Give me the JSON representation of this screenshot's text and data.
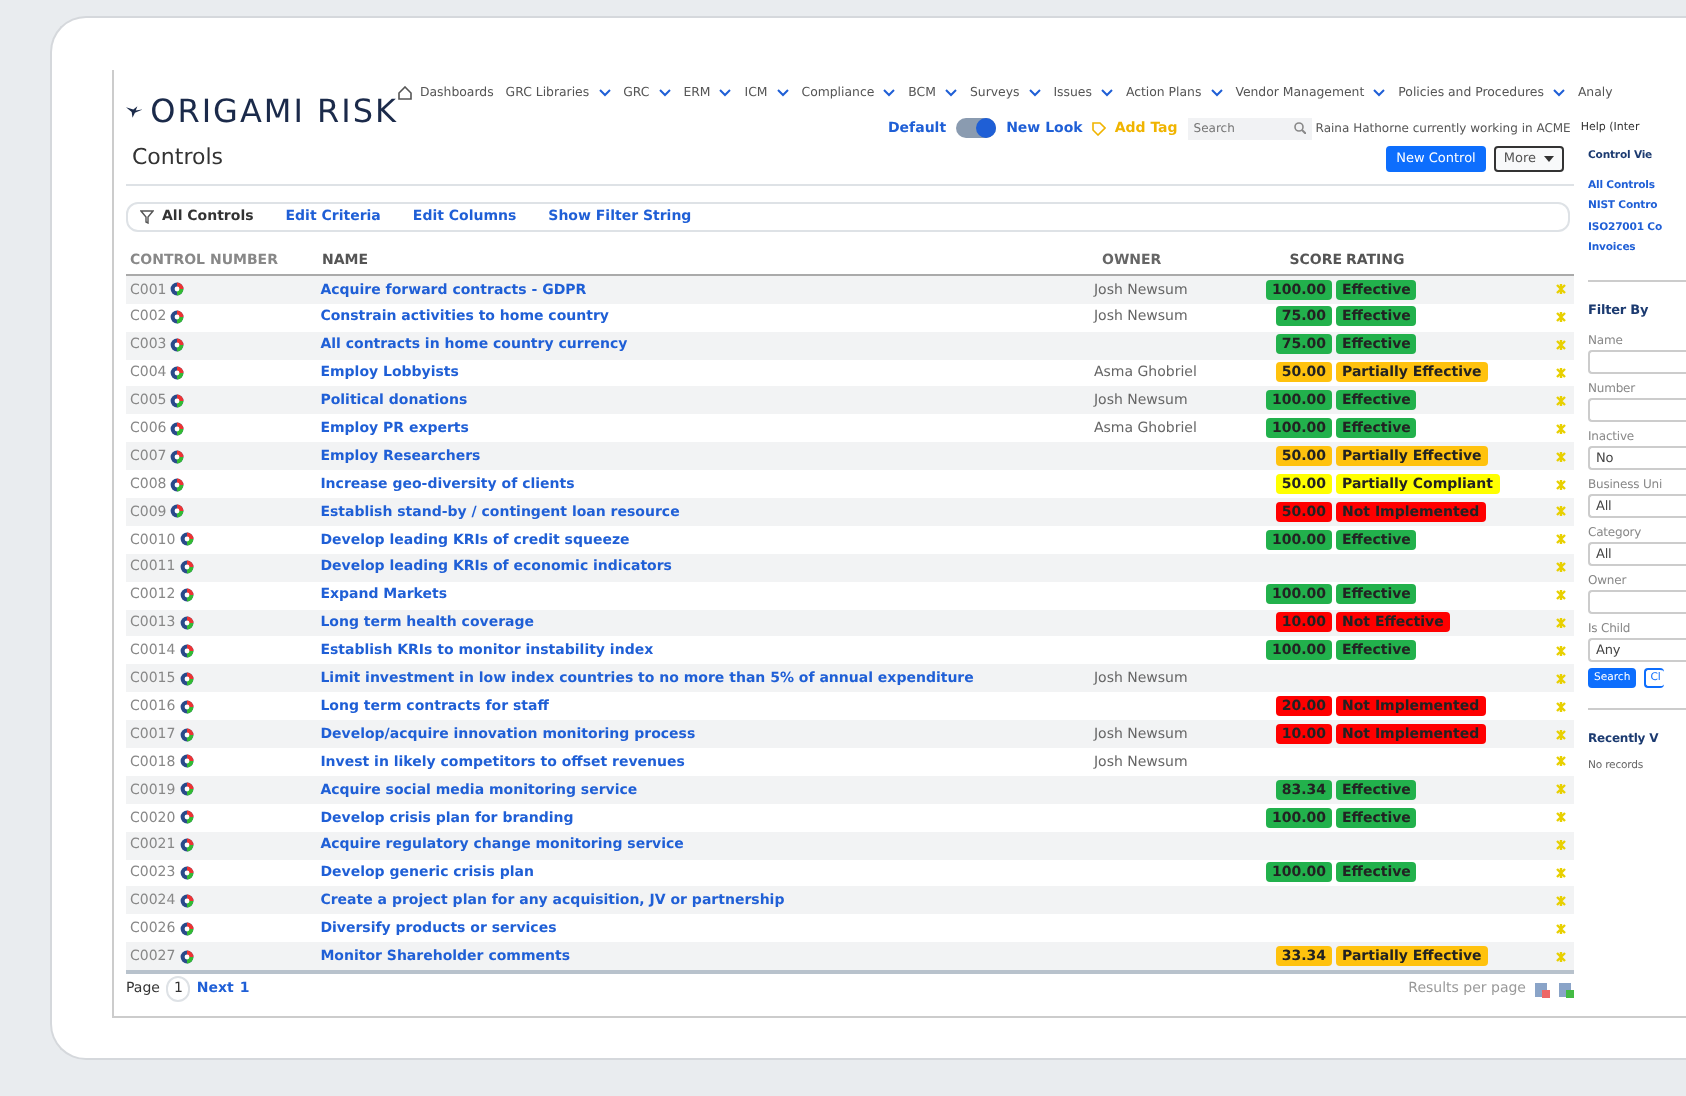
{
  "logo": {
    "text": "ORIGAMI RISK"
  },
  "nav": [
    {
      "label": "Dashboards",
      "kind": "home"
    },
    {
      "label": "GRC Libraries",
      "kind": "menu"
    },
    {
      "label": "GRC",
      "kind": "menu"
    },
    {
      "label": "ERM",
      "kind": "menu"
    },
    {
      "label": "ICM",
      "kind": "menu"
    },
    {
      "label": "Compliance",
      "kind": "menu"
    },
    {
      "label": "BCM",
      "kind": "menu"
    },
    {
      "label": "Surveys",
      "kind": "menu"
    },
    {
      "label": "Issues",
      "kind": "menu"
    },
    {
      "label": "Action Plans",
      "kind": "menu"
    },
    {
      "label": "Vendor Management",
      "kind": "menu"
    },
    {
      "label": "Policies and Procedures",
      "kind": "menu"
    },
    {
      "label": "Analy",
      "kind": "plain"
    }
  ],
  "toolbar": {
    "theme": "Default",
    "new_look": "New Look",
    "new_look_on": true,
    "add_tag": "Add Tag",
    "search_placeholder": "Search",
    "user_note": "Raina Hathorne currently working in ACME",
    "help": "Help (Inter"
  },
  "page_title": "Controls",
  "buttons": [
    {
      "label": "New Control",
      "kind": "primary"
    },
    {
      "label": "More",
      "kind": "dropdown"
    }
  ],
  "filter_bar": {
    "view": "All Controls",
    "links": [
      "Edit Criteria",
      "Edit Columns",
      "Show Filter String"
    ]
  },
  "table": {
    "columns": [
      "CONTROL NUMBER",
      "NAME",
      "OWNER",
      "SCORE",
      "RATING"
    ],
    "rows": [
      {
        "number": "C001",
        "name": "Acquire forward contracts - GDPR",
        "owner": "Josh Newsum",
        "score": "100.00",
        "rating": "Effective",
        "color": "#22b14c"
      },
      {
        "number": "C002",
        "name": "Constrain activities to home country",
        "owner": "Josh Newsum",
        "score": "75.00",
        "rating": "Effective",
        "color": "#22b14c"
      },
      {
        "number": "C003",
        "name": "All contracts in home country currency",
        "score": "75.00",
        "rating": "Effective",
        "color": "#22b14c"
      },
      {
        "number": "C004",
        "name": "Employ Lobbyists",
        "owner": "Asma Ghobriel",
        "score": "50.00",
        "rating": "Partially Effective",
        "color": "#ffc20e"
      },
      {
        "number": "C005",
        "name": "Political donations",
        "owner": "Josh Newsum",
        "score": "100.00",
        "rating": "Effective",
        "color": "#22b14c"
      },
      {
        "number": "C006",
        "name": "Employ PR experts",
        "owner": "Asma Ghobriel",
        "score": "100.00",
        "rating": "Effective",
        "color": "#22b14c"
      },
      {
        "number": "C007",
        "name": "Employ Researchers",
        "score": "50.00",
        "rating": "Partially Effective",
        "color": "#ffc20e"
      },
      {
        "number": "C008",
        "name": "Increase geo-diversity of clients",
        "score": "50.00",
        "rating": "Partially Compliant",
        "color": "#ffff00"
      },
      {
        "number": "C009",
        "name": "Establish stand-by / contingent loan resource",
        "score": "50.00",
        "rating": "Not Implemented",
        "color": "#ff0000"
      },
      {
        "number": "C0010",
        "name": "Develop leading KRIs of credit squeeze",
        "score": "100.00",
        "rating": "Effective",
        "color": "#22b14c"
      },
      {
        "number": "C0011",
        "name": "Develop leading KRIs of economic indicators"
      },
      {
        "number": "C0012",
        "name": "Expand Markets",
        "score": "100.00",
        "rating": "Effective",
        "color": "#22b14c"
      },
      {
        "number": "C0013",
        "name": "Long term health coverage",
        "score": "10.00",
        "rating": "Not Effective",
        "color": "#ff0000"
      },
      {
        "number": "C0014",
        "name": "Establish KRIs to monitor instability index",
        "score": "100.00",
        "rating": "Effective",
        "color": "#22b14c"
      },
      {
        "number": "C0015",
        "name": "Limit investment in low index countries to no more than 5% of annual expenditure",
        "owner": "Josh Newsum"
      },
      {
        "number": "C0016",
        "name": "Long term contracts for staff",
        "score": "20.00",
        "rating": "Not Implemented",
        "color": "#ff0000"
      },
      {
        "number": "C0017",
        "name": "Develop/acquire innovation monitoring process",
        "owner": "Josh Newsum",
        "score": "10.00",
        "rating": "Not Implemented",
        "color": "#ff0000"
      },
      {
        "number": "C0018",
        "name": "Invest in likely competitors to offset revenues",
        "owner": "Josh Newsum"
      },
      {
        "number": "C0019",
        "name": "Acquire social media monitoring service",
        "score": "83.34",
        "rating": "Effective",
        "color": "#22b14c"
      },
      {
        "number": "C0020",
        "name": "Develop crisis plan for branding",
        "score": "100.00",
        "rating": "Effective",
        "color": "#22b14c"
      },
      {
        "number": "C0021",
        "name": "Acquire regulatory change monitoring service"
      },
      {
        "number": "C0023",
        "name": "Develop generic crisis plan",
        "score": "100.00",
        "rating": "Effective",
        "color": "#22b14c"
      },
      {
        "number": "C0024",
        "name": "Create a project plan for any acquisition, JV or partnership"
      },
      {
        "number": "C0026",
        "name": "Diversify products or services"
      },
      {
        "number": "C0027",
        "name": "Monitor Shareholder comments",
        "score": "33.34",
        "rating": "Partially Effective",
        "color": "#ffc20e"
      }
    ]
  },
  "pager": {
    "label": "Page",
    "page": "1",
    "next": "Next",
    "total": "1",
    "results_label": "Results per page"
  },
  "sidebar": {
    "views_title": "Control Vie",
    "views": [
      "All Controls",
      "NIST Contro",
      "ISO27001 Co",
      "Invoices"
    ],
    "filter_title": "Filter By",
    "filters": [
      {
        "label": "Name"
      },
      {
        "label": "Number"
      },
      {
        "label": "Inactive",
        "value": "No"
      },
      {
        "label": "Business Uni",
        "value": "All"
      },
      {
        "label": "Category",
        "value": "All"
      },
      {
        "label": "Owner"
      },
      {
        "label": "Is Child",
        "value": "Any"
      }
    ],
    "search_button": "Search",
    "clear_button": "Cl",
    "recent_title": "Recently V",
    "recent_empty": "No records"
  }
}
